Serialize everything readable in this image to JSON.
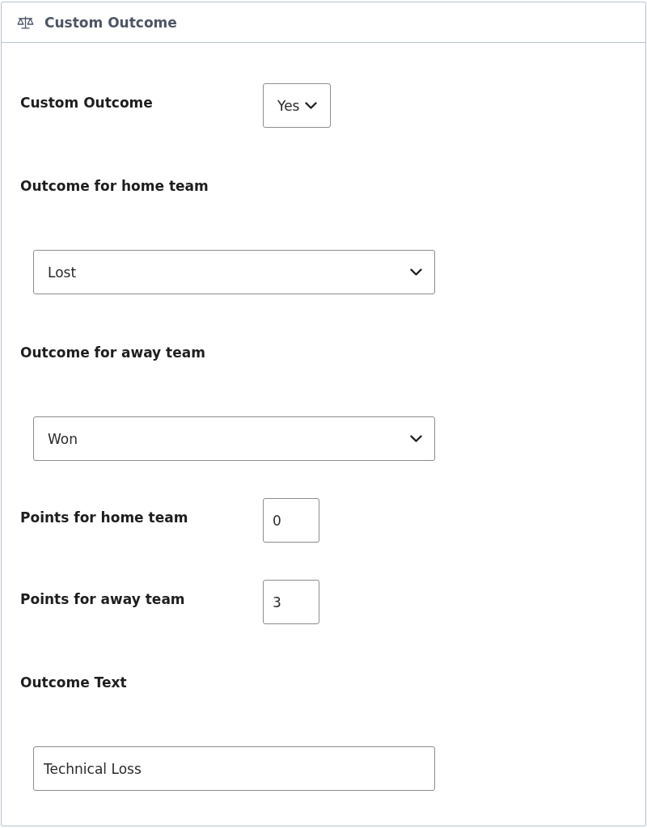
{
  "panel": {
    "title": "Custom Outcome"
  },
  "fields": [
    {
      "kind": "inline-select",
      "label": "Custom Outcome",
      "value": "Yes"
    },
    {
      "kind": "block-select",
      "label": "Outcome for home team",
      "value": "Lost"
    },
    {
      "kind": "block-select",
      "label": "Outcome for away team",
      "value": "Won"
    },
    {
      "kind": "inline-number",
      "label": "Points for home team",
      "value": "0"
    },
    {
      "kind": "inline-number",
      "label": "Points for away team",
      "value": "3"
    },
    {
      "kind": "block-text",
      "label": "Outcome Text",
      "value": "Technical Loss"
    }
  ]
}
